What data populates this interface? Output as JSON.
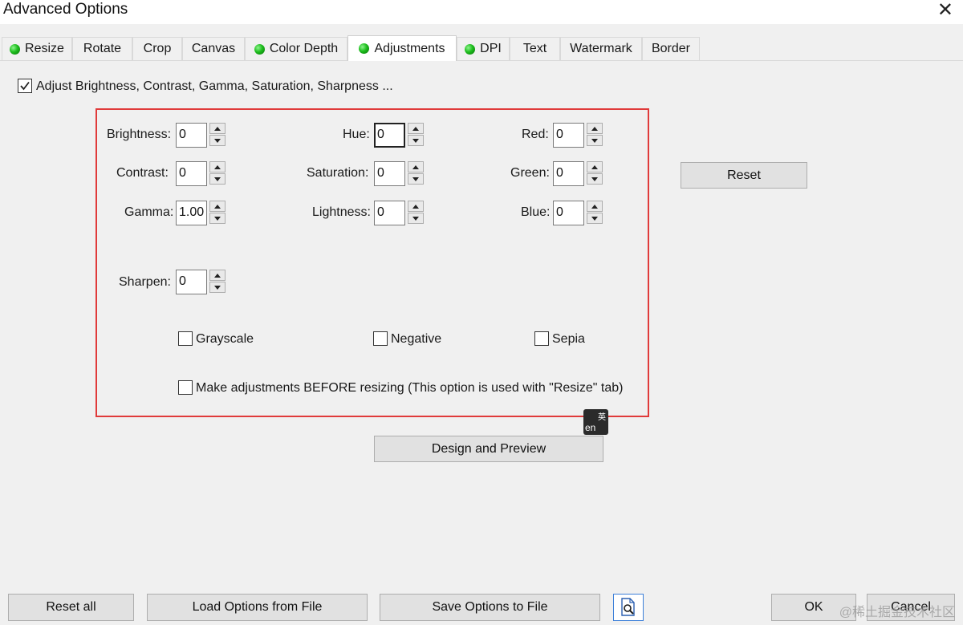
{
  "window": {
    "title": "Advanced Options",
    "close_glyph": "✕"
  },
  "tabs": [
    {
      "label": "Resize",
      "dot": true
    },
    {
      "label": "Rotate",
      "dot": false
    },
    {
      "label": "Crop",
      "dot": false
    },
    {
      "label": "Canvas",
      "dot": false
    },
    {
      "label": "Color Depth",
      "dot": true
    },
    {
      "label": "Adjustments",
      "dot": true,
      "active": true
    },
    {
      "label": "DPI",
      "dot": true
    },
    {
      "label": "Text",
      "dot": false
    },
    {
      "label": "Watermark",
      "dot": false
    },
    {
      "label": "Border",
      "dot": false
    }
  ],
  "adjust": {
    "enable_label": "Adjust Brightness, Contrast, Gamma, Saturation, Sharpness ...",
    "enable_checked": true,
    "brightness": {
      "label": "Brightness:",
      "value": "0"
    },
    "contrast": {
      "label": "Contrast:",
      "value": "0"
    },
    "gamma": {
      "label": "Gamma:",
      "value": "1.00"
    },
    "sharpen": {
      "label": "Sharpen:",
      "value": "0"
    },
    "hue": {
      "label": "Hue:",
      "value": "0"
    },
    "saturation": {
      "label": "Saturation:",
      "value": "0"
    },
    "lightness": {
      "label": "Lightness:",
      "value": "0"
    },
    "red": {
      "label": "Red:",
      "value": "0"
    },
    "green": {
      "label": "Green:",
      "value": "0"
    },
    "blue": {
      "label": "Blue:",
      "value": "0"
    },
    "grayscale": {
      "label": "Grayscale",
      "checked": false
    },
    "negative": {
      "label": "Negative",
      "checked": false
    },
    "sepia": {
      "label": "Sepia",
      "checked": false
    },
    "before_resize": {
      "label": "Make adjustments BEFORE resizing (This option is used with \"Resize\" tab)",
      "checked": false
    },
    "reset_label": "Reset",
    "design_preview_label": "Design and Preview"
  },
  "ime": {
    "en": "en",
    "zh": "英"
  },
  "footer": {
    "reset_all": "Reset all",
    "load": "Load Options from File",
    "save": "Save Options to File",
    "ok": "OK",
    "cancel": "Cancel"
  },
  "watermark": "@稀土掘金技术社区",
  "colors": {
    "highlight_border": "#e03a3a",
    "status_dot": "#1dbd1d"
  }
}
